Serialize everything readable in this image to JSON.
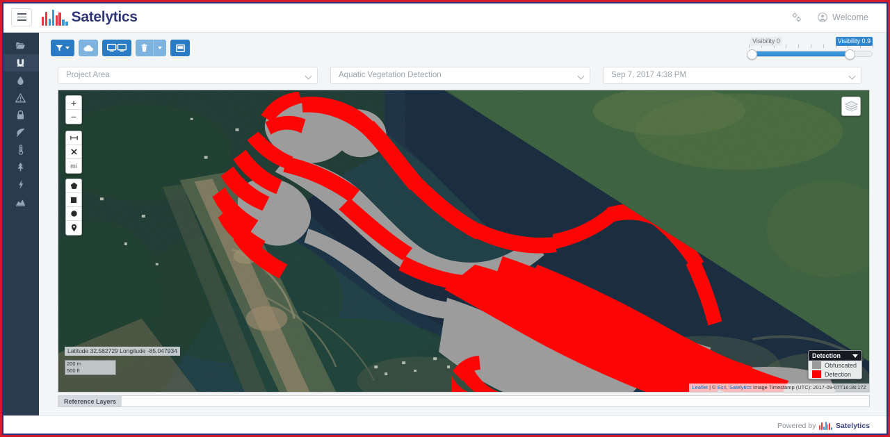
{
  "header": {
    "menu_icon": "hamburger-icon",
    "brand": "Satelytics",
    "settings_icon": "settings-gear-icon",
    "user_icon": "user-avatar-icon",
    "welcome_label": "Welcome"
  },
  "sidebar": {
    "items": [
      {
        "icon": "folder-open-icon",
        "name": "projects",
        "active": false
      },
      {
        "icon": "magnet-icon",
        "name": "magnet",
        "active": true
      },
      {
        "icon": "droplet-icon",
        "name": "water-quality",
        "active": false
      },
      {
        "icon": "warning-triangle-icon",
        "name": "alerts",
        "active": false
      },
      {
        "icon": "lock-icon",
        "name": "security",
        "active": false
      },
      {
        "icon": "leaf-icon",
        "name": "vegetation",
        "active": false
      },
      {
        "icon": "thermometer-icon",
        "name": "temperature",
        "active": false
      },
      {
        "icon": "tree-icon",
        "name": "forestry",
        "active": false
      },
      {
        "icon": "bolt-icon",
        "name": "energy",
        "active": false
      },
      {
        "icon": "chart-icon",
        "name": "analytics",
        "active": false
      }
    ]
  },
  "toolbar": {
    "buttons": [
      {
        "name": "filter-button",
        "icon": "funnel-icon",
        "style": "primary",
        "has_caret": true
      },
      {
        "name": "cloud-button",
        "icon": "cloud-icon",
        "style": "light",
        "has_caret": false
      },
      {
        "name": "compare-button",
        "icon": "dual-screen-icon",
        "style": "primary",
        "has_caret": false
      },
      {
        "name": "delete-button",
        "icon": "trash-icon",
        "style": "light",
        "has_caret": true
      },
      {
        "name": "report-button",
        "icon": "panel-icon",
        "style": "primary",
        "has_caret": false
      }
    ]
  },
  "visibility_slider": {
    "min_label": "Visibility 0",
    "max_label": "Visibility 0.9",
    "min_value": 0,
    "max_value": 0.9,
    "range": [
      0,
      1
    ],
    "tick_count": 10,
    "accent_color": "#2f86ce"
  },
  "selectors": {
    "project_area": {
      "value": "Project Area",
      "placeholder": "Project Area"
    },
    "analysis": {
      "value": "Aquatic Vegetation Detection",
      "placeholder": "Analysis"
    },
    "date": {
      "value": "Sep 7, 2017 4:38 PM",
      "placeholder": "Date"
    }
  },
  "map": {
    "zoom_in_label": "+",
    "zoom_out_label": "−",
    "measure_icon": "ruler-icon",
    "measure_cancel_icon": "cancel-x-icon",
    "units_label": "mi",
    "draw_polygon_icon": "polygon-icon",
    "draw_rectangle_icon": "rectangle-icon",
    "draw_circle_icon": "circle-icon",
    "draw_marker_icon": "map-marker-icon",
    "layers_icon": "layers-stack-icon",
    "coordinates": "Latitude 32.582729 Longitude -85.047934",
    "scale_metric": "200 m",
    "scale_imperial": "500 ft",
    "attribution_prefix": "Leaflet",
    "attribution_sep": " | © ",
    "attribution_esri": "Esri, Satelytics",
    "attribution_timestamp": " Image Timestamp (UTC): 2017-09-07T16:38:17Z"
  },
  "legend": {
    "title": "Detection",
    "collapse_icon": "chevron-down-icon",
    "entries": [
      {
        "label": "Obfuscated",
        "color": "#9a9a9a"
      },
      {
        "label": "Detection",
        "color": "#fe0000"
      }
    ]
  },
  "reference_layers": {
    "tab_label": "Reference Layers"
  },
  "footer": {
    "powered_by": "Powered by",
    "brand": "Satelytics"
  },
  "colors": {
    "brand_navy": "#2e3676",
    "brand_red": "#d01c2c",
    "sidebar_bg": "#2b3b4e",
    "primary_blue": "#2b7ac4",
    "light_blue": "#7fb3df",
    "detection_red": "#fe0000",
    "obfuscated_grey": "#9a9a9a",
    "water_dark": "#16283a"
  }
}
